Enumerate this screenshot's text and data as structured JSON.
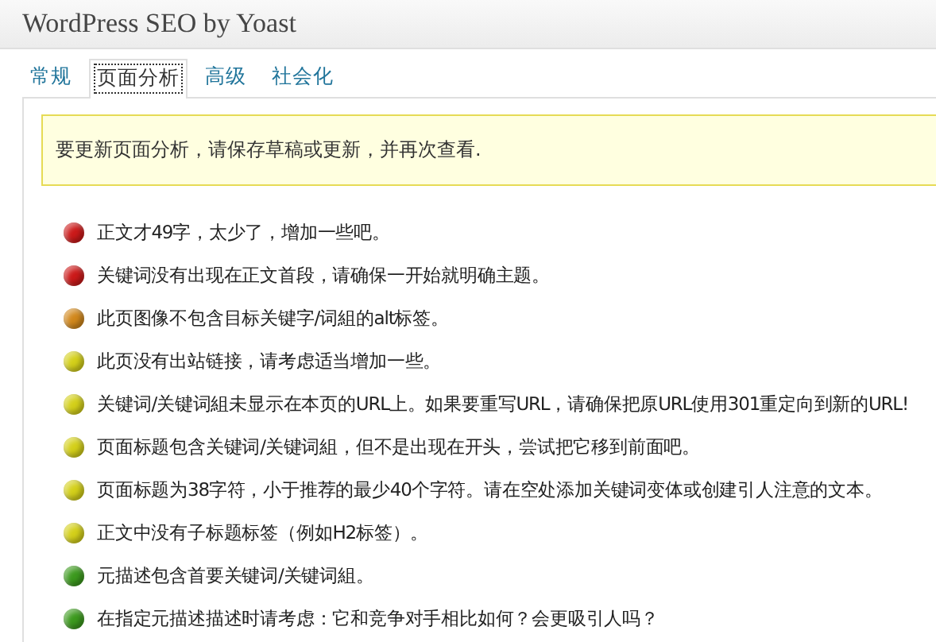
{
  "window": {
    "title": "WordPress SEO by Yoast"
  },
  "tabs": [
    {
      "label": "常规",
      "selected": false
    },
    {
      "label": "页面分析",
      "selected": true
    },
    {
      "label": "高级",
      "selected": false
    },
    {
      "label": "社会化",
      "selected": false
    }
  ],
  "notice": "要更新页面分析，请保存草稿或更新，并再次查看.",
  "results": [
    {
      "text": "正文才49字，太少了，增加一些吧。",
      "color": "#cc1a1a"
    },
    {
      "text": "关键词没有出现在正文首段，请确保一开始就明确主题。",
      "color": "#cc1a1a"
    },
    {
      "text": "此页图像不包含目标关键字/词組的alt标签。",
      "color": "#d2881c"
    },
    {
      "text": "此页没有出站链接，请考虑适当增加一些。",
      "color": "#d4d01a"
    },
    {
      "text": "关键词/关键词組未显示在本页的URL上。如果要重写URL，请确保把原URL使用301重定向到新的URL!",
      "color": "#d4d01a"
    },
    {
      "text": "页面标题包含关键词/关键词組，但不是出现在开头，尝试把它移到前面吧。",
      "color": "#d4d01a"
    },
    {
      "text": "页面标题为38字符，小于推荐的最少40个字符。请在空处添加关键词变体或创建引人注意的文本。",
      "color": "#d4d01a"
    },
    {
      "text": "正文中没有子标题标签（例如H2标签）。",
      "color": "#d4d01a"
    },
    {
      "text": "元描述包含首要关键词/关键词組。",
      "color": "#3c9a1e"
    },
    {
      "text": "在指定元描述描述时请考虑：它和竞争对手相比如何？会更吸引人吗？",
      "color": "#3c9a1e"
    }
  ]
}
